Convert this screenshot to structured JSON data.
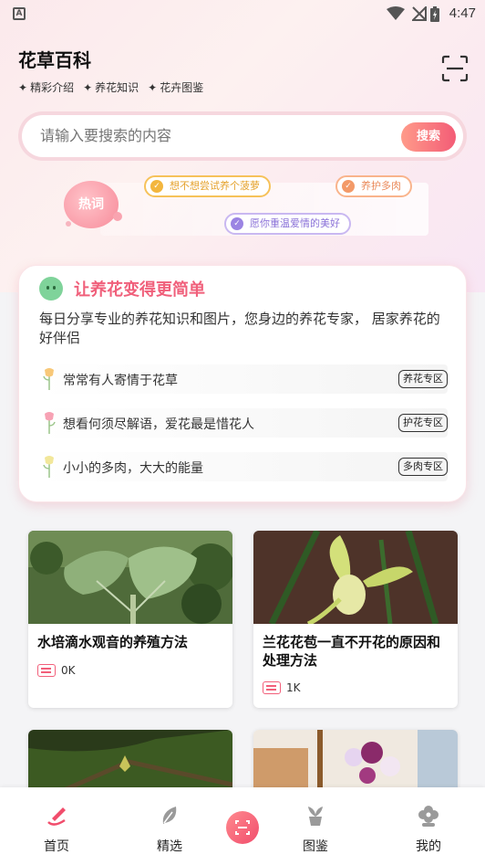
{
  "status_bar": {
    "time": "4:47"
  },
  "header": {
    "title": "花草百科",
    "subnav": [
      {
        "label": "精彩介绍"
      },
      {
        "label": "养花知识"
      },
      {
        "label": "花卉图鉴"
      }
    ]
  },
  "search": {
    "placeholder": "请输入要搜索的内容",
    "button": "搜索"
  },
  "hot": {
    "label": "热词",
    "tags": [
      "想不想尝试养个菠萝",
      "养护多肉",
      "愿你重温爱情的美好"
    ]
  },
  "intro": {
    "title": "让养花变得更简单",
    "desc": "每日分享专业的养花知识和图片，您身边的养花专家， 居家养花的好伴侣",
    "rows": [
      {
        "text": "常常有人寄情于花草",
        "badge": "养花专区"
      },
      {
        "text": "想看何须尽解语，爱花最是惜花人",
        "badge": "护花专区"
      },
      {
        "text": "小小的多肉，大大的能量",
        "badge": "多肉专区"
      }
    ]
  },
  "posts": [
    {
      "title": "水培滴水观音的养殖方法",
      "views": "0K"
    },
    {
      "title": "兰花花苞一直不开花的原因和处理方法",
      "views": "1K"
    }
  ],
  "tabbar": {
    "items": [
      {
        "label": "首页"
      },
      {
        "label": "精选"
      },
      {
        "label": "图鉴"
      },
      {
        "label": "我的"
      }
    ]
  },
  "colors": {
    "accent": "#f0607b",
    "brand_pink": "#f35c76"
  }
}
